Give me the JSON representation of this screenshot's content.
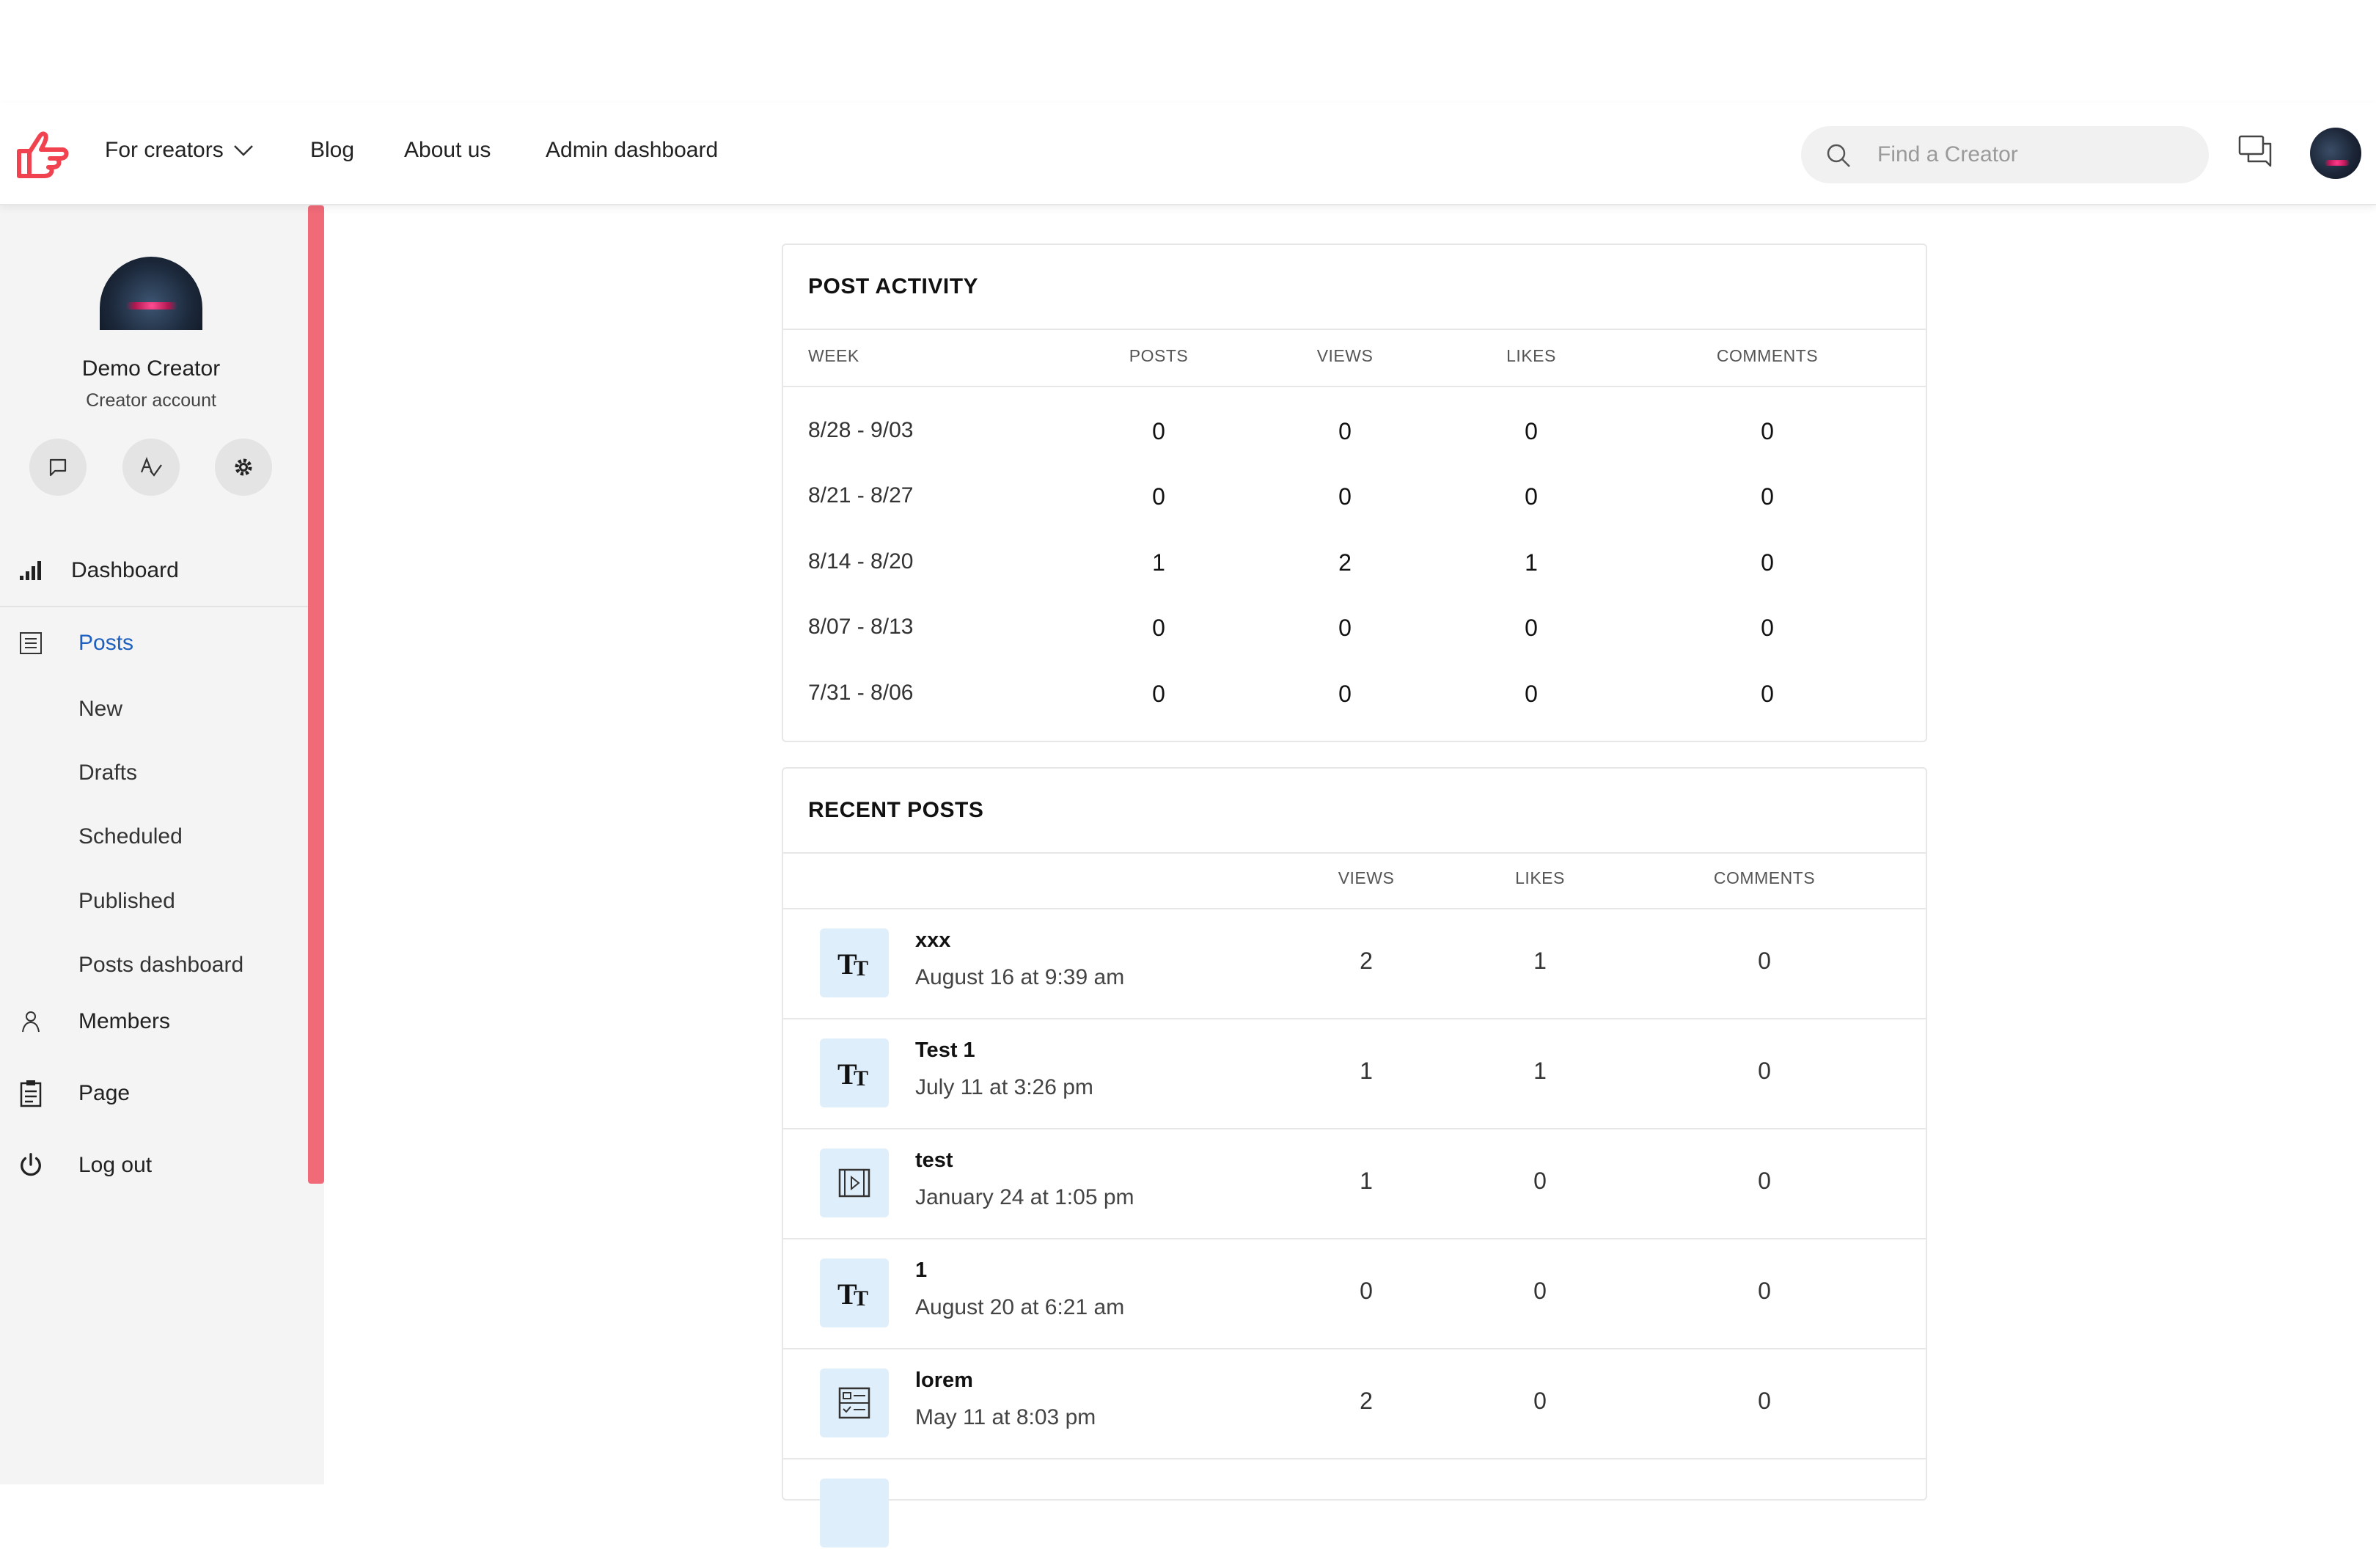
{
  "nav": {
    "for_creators": "For creators",
    "blog": "Blog",
    "about_us": "About us",
    "admin_dashboard": "Admin dashboard",
    "search_placeholder": "Find a Creator"
  },
  "profile": {
    "name": "Demo Creator",
    "role": "Creator account"
  },
  "sidebar": {
    "dashboard": "Dashboard",
    "posts": "Posts",
    "posts_sub": [
      "New",
      "Drafts",
      "Scheduled",
      "Published",
      "Posts dashboard"
    ],
    "members": "Members",
    "page": "Page",
    "logout": "Log out"
  },
  "post_activity": {
    "title": "POST ACTIVITY",
    "headers": [
      "WEEK",
      "POSTS",
      "VIEWS",
      "LIKES",
      "COMMENTS"
    ],
    "rows": [
      {
        "week": "8/28 - 9/03",
        "posts": "0",
        "views": "0",
        "likes": "0",
        "comments": "0"
      },
      {
        "week": "8/21 - 8/27",
        "posts": "0",
        "views": "0",
        "likes": "0",
        "comments": "0"
      },
      {
        "week": "8/14 - 8/20",
        "posts": "1",
        "views": "2",
        "likes": "1",
        "comments": "0"
      },
      {
        "week": "8/07 - 8/13",
        "posts": "0",
        "views": "0",
        "likes": "0",
        "comments": "0"
      },
      {
        "week": "7/31 - 8/06",
        "posts": "0",
        "views": "0",
        "likes": "0",
        "comments": "0"
      }
    ]
  },
  "recent_posts": {
    "title": "RECENT POSTS",
    "headers": [
      "VIEWS",
      "LIKES",
      "COMMENTS"
    ],
    "rows": [
      {
        "title": "xxx",
        "date": "August 16 at 9:39 am",
        "type": "text-icon",
        "views": "2",
        "likes": "1",
        "comments": "0"
      },
      {
        "title": "Test 1",
        "date": "July 11 at 3:26 pm",
        "type": "text-icon",
        "views": "1",
        "likes": "1",
        "comments": "0"
      },
      {
        "title": "test",
        "date": "January 24 at 1:05 pm",
        "type": "video-icon",
        "views": "1",
        "likes": "0",
        "comments": "0"
      },
      {
        "title": "1",
        "date": "August 20 at 6:21 am",
        "type": "text-icon",
        "views": "0",
        "likes": "0",
        "comments": "0"
      },
      {
        "title": "lorem",
        "date": "May 11 at 8:03 pm",
        "type": "poll-icon",
        "views": "2",
        "likes": "0",
        "comments": "0"
      }
    ]
  },
  "colors": {
    "accent_red": "#f0434f",
    "active_blue": "#1d5fbf",
    "scrollbar": "#f06a78",
    "thumb_bg": "#dfeefb"
  }
}
